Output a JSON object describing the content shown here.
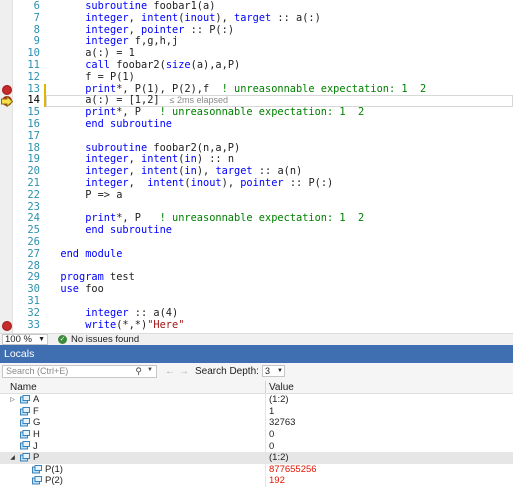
{
  "editor": {
    "lines": [
      {
        "no": "6",
        "html": "      <span class='kw'>subroutine</span> foobar1(a)"
      },
      {
        "no": "7",
        "html": "      <span class='kw'>integer</span>, <span class='kw'>intent</span>(<span class='kw'>inout</span>), <span class='kw'>target</span> :: a(:)"
      },
      {
        "no": "8",
        "html": "      <span class='kw'>integer</span>, <span class='kw'>pointer</span> :: P(:)"
      },
      {
        "no": "9",
        "html": "      <span class='kw'>integer</span> f,g,h,j"
      },
      {
        "no": "10",
        "html": "      a(:) = 1"
      },
      {
        "no": "11",
        "html": "      <span class='kw'>call</span> foobar2(<span class='kw'>size</span>(a),a,P)"
      },
      {
        "no": "12",
        "html": "      f = P(1)"
      },
      {
        "no": "13",
        "html": "      <span class='kw'>print</span>*, P(1), P(2),f  <span class='cm'>! unreasonnable expectation: 1  2</span>"
      },
      {
        "no": "14",
        "html": "      a(:) = [1,2]<span class='perf'>≤ 2ms elapsed</span>"
      },
      {
        "no": "15",
        "html": "      <span class='kw'>print</span>*, P   <span class='cm'>! unreasonnable expectation: 1  2</span>"
      },
      {
        "no": "16",
        "html": "      <span class='kw'>end subroutine</span>"
      },
      {
        "no": "17",
        "html": ""
      },
      {
        "no": "18",
        "html": "      <span class='kw'>subroutine</span> foobar2(n,a,P)"
      },
      {
        "no": "19",
        "html": "      <span class='kw'>integer</span>, <span class='kw'>intent</span>(<span class='kw'>in</span>) :: n"
      },
      {
        "no": "20",
        "html": "      <span class='kw'>integer</span>, <span class='kw'>intent</span>(<span class='kw'>in</span>), <span class='kw'>target</span> :: a(n)"
      },
      {
        "no": "21",
        "html": "      <span class='kw'>integer</span>,  <span class='kw'>intent</span>(<span class='kw'>inout</span>), <span class='kw'>pointer</span> :: P(:)"
      },
      {
        "no": "22",
        "html": "      P => a"
      },
      {
        "no": "23",
        "html": ""
      },
      {
        "no": "24",
        "html": "      <span class='kw'>print</span>*, P   <span class='cm'>! unreasonnable expectation: 1  2</span>"
      },
      {
        "no": "25",
        "html": "      <span class='kw'>end subroutine</span>"
      },
      {
        "no": "26",
        "html": ""
      },
      {
        "no": "27",
        "html": "  <span class='kw'>end module</span>"
      },
      {
        "no": "28",
        "html": ""
      },
      {
        "no": "29",
        "html": "  <span class='kw'>program</span> test"
      },
      {
        "no": "30",
        "html": "  <span class='kw'>use</span> foo"
      },
      {
        "no": "31",
        "html": ""
      },
      {
        "no": "32",
        "html": "      <span class='kw'>integer</span> :: a(4)"
      },
      {
        "no": "33",
        "html": "      <span class='kw'>write</span>(*,*)<span class='st'>\"Here\"</span>"
      }
    ],
    "current_line_index": 8,
    "breakpoint_line_indices": [
      7,
      8,
      27
    ],
    "accent_keyword": "#0000ff",
    "accent_comment": "#008000"
  },
  "statusbar": {
    "zoom": "100 %",
    "issues": "No issues found"
  },
  "locals": {
    "title": "Locals",
    "search_placeholder": "Search (Ctrl+E)",
    "search_depth_label": "Search Depth:",
    "search_depth_value": "3",
    "col_name": "Name",
    "col_value": "Value",
    "rows": [
      {
        "name": "A",
        "value": "(1:2)",
        "expander": "collapsed",
        "level": 0,
        "changed": false
      },
      {
        "name": "F",
        "value": "1",
        "expander": "none",
        "level": 0,
        "changed": false
      },
      {
        "name": "G",
        "value": "32763",
        "expander": "none",
        "level": 0,
        "changed": false
      },
      {
        "name": "H",
        "value": "0",
        "expander": "none",
        "level": 0,
        "changed": false
      },
      {
        "name": "J",
        "value": "0",
        "expander": "none",
        "level": 0,
        "changed": false
      },
      {
        "name": "P",
        "value": "(1:2)",
        "expander": "expanded",
        "level": 0,
        "changed": false,
        "selected": true
      },
      {
        "name": "P(1)",
        "value": "877655256",
        "expander": "none",
        "level": 1,
        "changed": true
      },
      {
        "name": "P(2)",
        "value": "192",
        "expander": "none",
        "level": 1,
        "changed": true
      }
    ],
    "changed_color": "#e51400",
    "title_bar_color": "#3f6fb1"
  }
}
